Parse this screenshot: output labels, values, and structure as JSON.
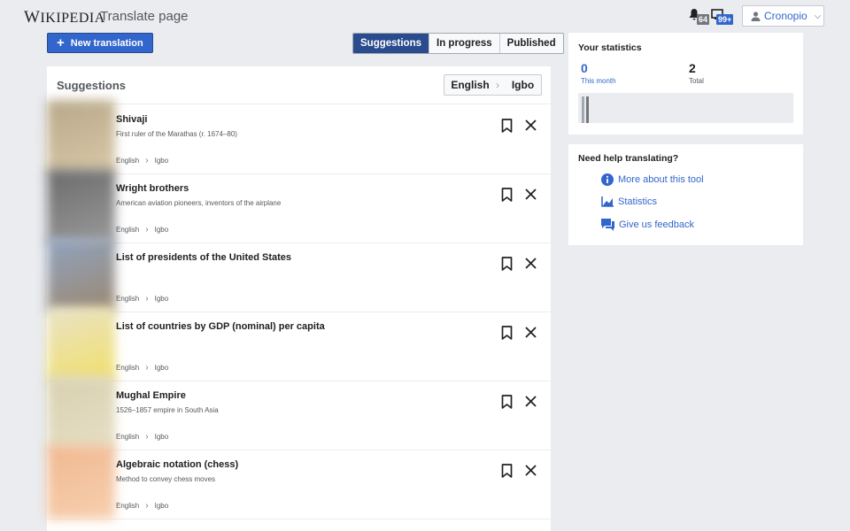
{
  "header": {
    "logo_prefix": "W",
    "logo_rest": "IKIPEDIA",
    "page_title": "Translate page",
    "alerts_count": "64",
    "notices_count": "99+",
    "username": "Cronopio"
  },
  "toolbar": {
    "new_translation": "New translation",
    "tabs": [
      {
        "label": "Suggestions",
        "active": true
      },
      {
        "label": "In progress",
        "active": false
      },
      {
        "label": "Published",
        "active": false
      }
    ]
  },
  "suggestions": {
    "title": "Suggestions",
    "source_lang": "English",
    "target_lang": "Igbo",
    "items": [
      {
        "title": "Shivaji",
        "desc": "First ruler of the Marathas (r. 1674–80)",
        "src": "English",
        "tgt": "Igbo",
        "thumb": [
          "#b8a88a",
          "#d9c9a8"
        ]
      },
      {
        "title": "Wright brothers",
        "desc": "American aviation pioneers, inventors of the airplane",
        "src": "English",
        "tgt": "Igbo",
        "thumb": [
          "#6b6b6b",
          "#9a9a9a"
        ]
      },
      {
        "title": "List of presidents of the United States",
        "desc": "",
        "src": "English",
        "tgt": "Igbo",
        "thumb": [
          "#8fa3c0",
          "#9c8870"
        ]
      },
      {
        "title": "List of countries by GDP (nominal) per capita",
        "desc": "",
        "src": "English",
        "tgt": "Igbo",
        "thumb": [
          "#e8e2c8",
          "#f2e06a"
        ]
      },
      {
        "title": "Mughal Empire",
        "desc": "1526–1857 empire in South Asia",
        "src": "English",
        "tgt": "Igbo",
        "thumb": [
          "#d8d0b0",
          "#e6dfc5"
        ]
      },
      {
        "title": "Algebraic notation (chess)",
        "desc": "Method to convey chess moves",
        "src": "English",
        "tgt": "Igbo",
        "thumb": [
          "#f0b890",
          "#f7d0b0"
        ]
      }
    ]
  },
  "stats": {
    "title": "Your statistics",
    "month_value": "0",
    "month_label": "This month",
    "total_value": "2",
    "total_label": "Total"
  },
  "help": {
    "title": "Need help translating?",
    "links": [
      "More about this tool",
      "Statistics",
      "Give us feedback"
    ]
  },
  "colors": {
    "accent": "#3366cc",
    "active_tab": "#2a4b8d",
    "background": "#eaecf0"
  }
}
